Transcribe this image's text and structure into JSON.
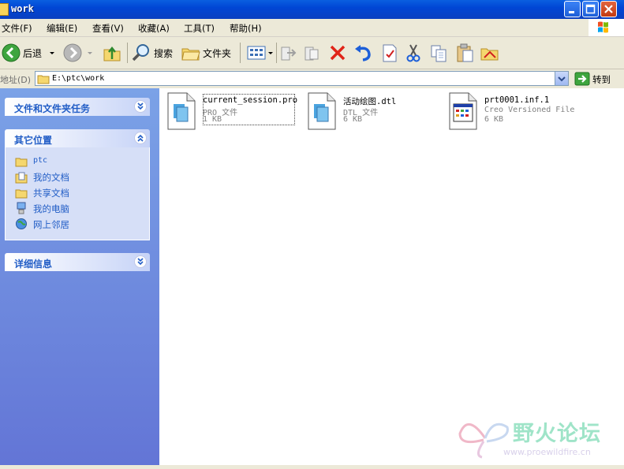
{
  "window": {
    "title": "work"
  },
  "menu": [
    "文件(F)",
    "编辑(E)",
    "查看(V)",
    "收藏(A)",
    "工具(T)",
    "帮助(H)"
  ],
  "toolbar": {
    "back_label": "后退",
    "search_label": "搜索",
    "folders_label": "文件夹"
  },
  "address": {
    "label": "地址(D)",
    "value": "E:\\ptc\\work",
    "go_label": "转到"
  },
  "sidebar": {
    "tasks_title": "文件和文件夹任务",
    "places_title": "其它位置",
    "places": [
      {
        "label": "ptc",
        "icon": "folder-icon"
      },
      {
        "label": "我的文档",
        "icon": "my-documents-icon"
      },
      {
        "label": "共享文档",
        "icon": "folder-icon"
      },
      {
        "label": "我的电脑",
        "icon": "my-computer-icon"
      },
      {
        "label": "网上邻居",
        "icon": "network-places-icon"
      }
    ],
    "details_title": "详细信息"
  },
  "files": [
    {
      "name": "current_session.pro",
      "type": "PRO 文件",
      "size": "1 KB",
      "selected": true
    },
    {
      "name": "活动绘图.dtl",
      "type": "DTL 文件",
      "size": "6 KB",
      "selected": false
    },
    {
      "name": "prt0001.inf.1",
      "type": "Creo Versioned File",
      "size": "6 KB",
      "selected": false
    }
  ],
  "watermark": {
    "text": "野火论坛",
    "url": "www.proewildfire.cn"
  },
  "colors": {
    "sidebar_link": "#215dc6",
    "title_bar": "#0046d5",
    "close_button": "#c23a12"
  }
}
